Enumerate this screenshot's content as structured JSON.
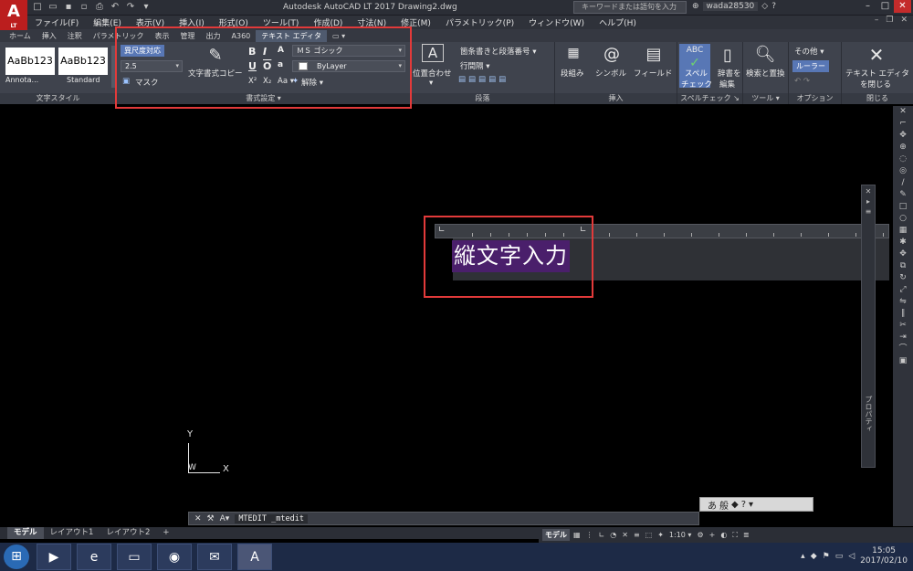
{
  "window": {
    "title": "Autodesk AutoCAD LT 2017    Drawing2.dwg",
    "app_logo": "A",
    "app_logo_sub": "LT",
    "search_placeholder": "キーワードまたは語句を入力",
    "username": "wada28530",
    "help_label": "?"
  },
  "menu": {
    "items": [
      "ファイル(F)",
      "編集(E)",
      "表示(V)",
      "挿入(I)",
      "形式(O)",
      "ツール(T)",
      "作成(D)",
      "寸法(N)",
      "修正(M)",
      "パラメトリック(P)",
      "ウィンドウ(W)",
      "ヘルプ(H)"
    ]
  },
  "tabs": {
    "items": [
      "ホーム",
      "挿入",
      "注釈",
      "パラメトリック",
      "表示",
      "管理",
      "出力",
      "A360",
      "テキスト エディタ",
      "▭ ▾"
    ],
    "active_index": 8
  },
  "ribbon": {
    "style_panel": {
      "title": "文字スタイル",
      "card1_text": "AaBb123",
      "card1_name": "Annota...",
      "card2_text": "AaBb123",
      "card2_name": "Standard"
    },
    "format_panel": {
      "title": "書式設定 ▾",
      "annotative_label": "異尺度対応",
      "height_value": "2.5",
      "mask_label": "マスク",
      "match_label": "文字書式コピー",
      "font_value": "ＭＳ ゴシック",
      "color_value": "ByLayer",
      "clear_label": "解除 ▾",
      "bold": "B",
      "italic": "I",
      "underline": "U",
      "overline": "O",
      "superscript": "X²",
      "subscript": "X₂",
      "case_label": "Aa ▾"
    },
    "paragraph_panel": {
      "title": "段落",
      "justify_label": "位置合わせ",
      "bullets_label": "箇条書きと段落番号 ▾",
      "spacing_label": "行間隔 ▾"
    },
    "insert_panel": {
      "title": "挿入",
      "columns_label": "段組み",
      "symbol_label": "シンボル",
      "field_label": "フィールド"
    },
    "spell_panel": {
      "title": "スペルチェック ↘",
      "spell_label1": "スペル",
      "spell_label2": "チェック",
      "dict_label1": "辞書を",
      "dict_label2": "編集"
    },
    "tools_panel": {
      "title": "ツール ▾",
      "find_label": "検索と置換"
    },
    "options_panel": {
      "title": "オプション",
      "more_label": "その他 ▾",
      "ruler_label": "ルーラー"
    },
    "close_panel": {
      "title": "閉じる",
      "close_label1": "テキスト エディタ",
      "close_label2": "を閉じる"
    }
  },
  "editor": {
    "text": "縦文字入力"
  },
  "ucs": {
    "y_label": "Y",
    "x_label": "X",
    "w_label": "W"
  },
  "properties_palette": {
    "label": "プロパティ"
  },
  "command_line": {
    "prompt": "MTEDIT _mtedit"
  },
  "layouts": {
    "items": [
      "モデル",
      "レイアウト1",
      "レイアウト2",
      "+"
    ],
    "active_index": 0
  },
  "status": {
    "model_label": "モデル",
    "scale_label": "1:10 ▾"
  },
  "taskbar": {
    "time": "15:05",
    "date": "2017/02/10"
  },
  "colors": {
    "highlight_border": "#e23a3a",
    "active_tab": "#4f5a6e",
    "text_selection": "#4a1f6b",
    "close_button": "#c42b2b"
  }
}
